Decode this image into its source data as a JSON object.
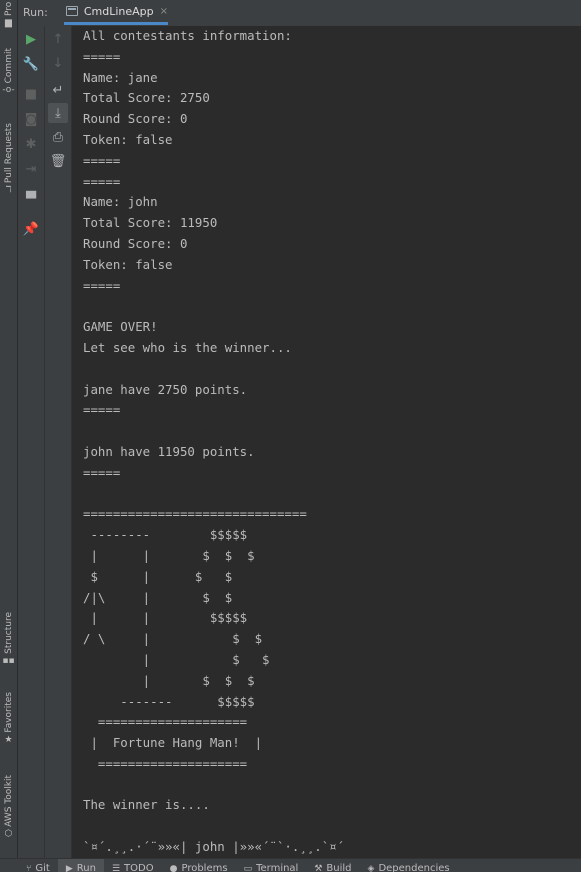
{
  "left_strip": {
    "project": "Pro",
    "commit": "Commit",
    "pull_requests": "Pull Requests",
    "structure": "Structure",
    "favorites": "Favorites",
    "aws_toolkit": "AWS Toolkit"
  },
  "run_panel": {
    "label": "Run:",
    "tab_name": "CmdLineApp",
    "tab_close": "×"
  },
  "console_text": "All contestants information:\n=====\nName: jane\nTotal Score: 2750\nRound Score: 0\nToken: false\n=====\n=====\nName: john\nTotal Score: 11950\nRound Score: 0\nToken: false\n=====\n\nGAME OVER!\nLet see who is the winner...\n\njane have 2750 points.\n=====\n\njohn have 11950 points.\n=====\n\n==============================\n --------        $$$$$\n |      |       $  $  $\n $      |      $   $\n/|\\     |       $  $\n |      |        $$$$$\n/ \\     |           $  $\n        |           $   $\n        |       $  $  $\n     -------      $$$$$\n  ====================\n |  Fortune Hang Man!  |\n  ====================\n\nThe winner is....\n\n`¤´.¸¸.·´¨»»«| john |»»«´¨`·.¸¸.`¤´",
  "bottom_bar": {
    "git": "Git",
    "run": "Run",
    "todo": "TODO",
    "problems": "Problems",
    "terminal": "Terminal",
    "build": "Build",
    "dependencies": "Dependencies"
  },
  "colors": {
    "panel": "#3c3f41",
    "console_bg": "#2b2b2b",
    "console_text": "#bbbbbb",
    "run_green": "#59a869",
    "tab_underline": "#4a88c7"
  }
}
